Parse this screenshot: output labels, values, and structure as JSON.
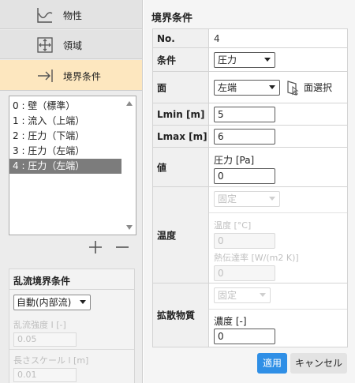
{
  "nav": {
    "items": [
      {
        "label": "物性",
        "icon": "material-icon"
      },
      {
        "label": "領域",
        "icon": "domain-icon"
      },
      {
        "label": "境界条件",
        "icon": "boundary-arrow-icon",
        "active": true
      }
    ]
  },
  "bc_list": {
    "items": [
      "0 : 壁（標準）",
      "1 : 流入（上端）",
      "2 : 圧力（下端）",
      "3 : 圧力（左端）",
      "4 : 圧力（左端）"
    ],
    "selected_index": 4
  },
  "list_actions": {
    "add": "+",
    "remove": "—"
  },
  "turbulence": {
    "title": "乱流境界条件",
    "mode": "自動(内部流)",
    "intensity_label": "乱流強度 I [-]",
    "intensity_value": "0.05",
    "length_label": "長さスケール l [m]",
    "length_value": "0.01"
  },
  "panel": {
    "title": "境界条件",
    "no_label": "No.",
    "no_value": "4",
    "condition_label": "条件",
    "condition_value": "圧力",
    "face_label": "面",
    "face_value": "左端",
    "face_select_label": "面選択",
    "lmin_label": "Lmin [m]",
    "lmin_value": "5",
    "lmax_label": "Lmax [m]",
    "lmax_value": "6",
    "value_label": "値",
    "pressure_label": "圧力 [Pa]",
    "pressure_value": "0",
    "temp_label": "温度",
    "temp_mode": "固定",
    "temp_sublabel": "温度 [°C]",
    "temp_value": "0",
    "htc_label": "熱伝達率 [W/(m2 K)]",
    "htc_value": "0",
    "diff_label": "拡散物質",
    "diff_mode": "固定",
    "conc_label": "濃度 [-]",
    "conc_value": "0"
  },
  "buttons": {
    "apply": "適用",
    "cancel": "キャンセル"
  },
  "colors": {
    "active_nav": "#fde7bf",
    "apply": "#2f8fe6",
    "selected_item": "#7c7c7c"
  }
}
